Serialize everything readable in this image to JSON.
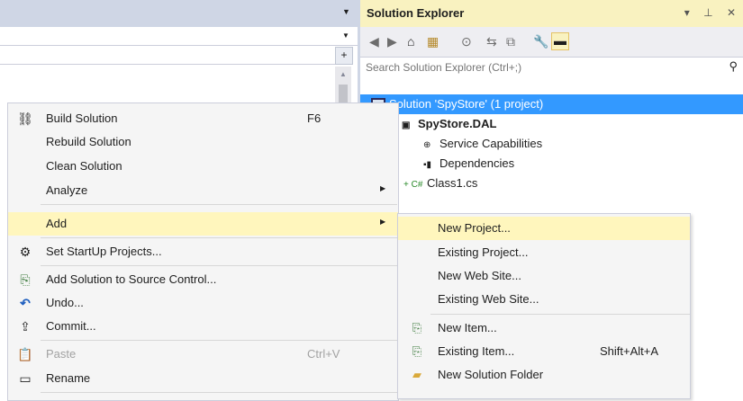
{
  "colors": {
    "accent_selection": "#3399ff",
    "menu_highlight": "#fff6bd",
    "titlebar": "#f9f2c0"
  },
  "editor": {
    "dropdown_icon": "chevron-down-icon"
  },
  "solution_explorer": {
    "title": "Solution Explorer",
    "title_icons": "▾ ⊥ ✕",
    "search": {
      "placeholder": "Search Solution Explorer (Ctrl+;)"
    },
    "tree": {
      "solution": "Solution 'SpyStore' (1 project)",
      "project": "SpyStore.DAL",
      "items": [
        {
          "label": "Service Capabilities",
          "icon": "connected-service-icon"
        },
        {
          "label": "Dependencies",
          "icon": "dependencies-icon"
        },
        {
          "label": "Class1.cs",
          "icon": "csharp-file-icon",
          "badge": "+ C#"
        }
      ]
    }
  },
  "context_menu": {
    "items": [
      {
        "label": "Build Solution",
        "shortcut": "F6",
        "icon": "build-icon"
      },
      {
        "label": "Rebuild Solution"
      },
      {
        "label": "Clean Solution"
      },
      {
        "label": "Analyze",
        "submenu": true
      },
      {
        "label": "Add",
        "submenu": true,
        "highlighted": true
      },
      {
        "label": "Set StartUp Projects...",
        "icon": "gear-icon"
      },
      {
        "label": "Add Solution to Source Control...",
        "icon": "add-source-control-icon"
      },
      {
        "label": "Undo...",
        "icon": "undo-icon"
      },
      {
        "label": "Commit...",
        "icon": "commit-icon"
      },
      {
        "label": "Paste",
        "shortcut": "Ctrl+V",
        "icon": "paste-icon",
        "disabled": true
      },
      {
        "label": "Rename",
        "icon": "rename-icon"
      }
    ]
  },
  "add_submenu": {
    "items": [
      {
        "label": "New Project...",
        "highlighted": true
      },
      {
        "label": "Existing Project..."
      },
      {
        "label": "New Web Site..."
      },
      {
        "label": "Existing Web Site..."
      },
      {
        "label": "New Item...",
        "icon": "new-item-icon"
      },
      {
        "label": "Existing Item...",
        "shortcut": "Shift+Alt+A",
        "icon": "existing-item-icon"
      },
      {
        "label": "New Solution Folder",
        "icon": "folder-icon"
      }
    ]
  }
}
